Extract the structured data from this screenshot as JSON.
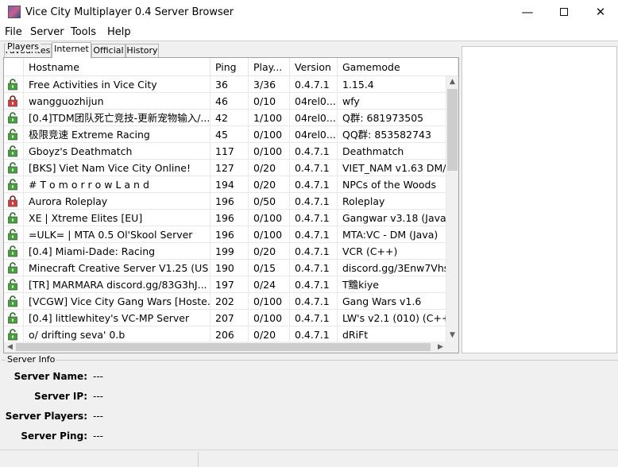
{
  "window": {
    "title": "Vice City Multiplayer 0.4 Server Browser"
  },
  "menu": [
    "File",
    "Server",
    "Tools",
    "Help"
  ],
  "tabs": [
    {
      "label": "Favourites",
      "active": false
    },
    {
      "label": "Internet",
      "active": true
    },
    {
      "label": "Official",
      "active": false
    },
    {
      "label": "History",
      "active": false
    }
  ],
  "columns": [
    "Hostname",
    "Ping",
    "Play...",
    "Version",
    "Gamemode"
  ],
  "servers": [
    {
      "locked": false,
      "host": "Free Activities in Vice City",
      "ping": "36",
      "players": "3/36",
      "version": "0.4.7.1",
      "gamemode": "1.15.4"
    },
    {
      "locked": true,
      "host": " wangguozhijun",
      "ping": "46",
      "players": "0/10",
      "version": "04rel0...",
      "gamemode": "wfy"
    },
    {
      "locked": false,
      "host": "[0.4]TDM团队死亡竞技-更新宠物输入/...",
      "ping": "42",
      "players": "1/100",
      "version": "04rel0...",
      "gamemode": "Q群: 681973505"
    },
    {
      "locked": false,
      "host": "极限竞速 Extreme Racing",
      "ping": "45",
      "players": "0/100",
      "version": "04rel0...",
      "gamemode": "QQ群:  853582743"
    },
    {
      "locked": false,
      "host": "Gboyz's Deathmatch",
      "ping": "117",
      "players": "0/100",
      "version": "0.4.7.1",
      "gamemode": "Deathmatch"
    },
    {
      "locked": false,
      "host": "[BKS] Viet Nam Vice City Online!",
      "ping": "127",
      "players": "0/20",
      "version": "0.4.7.1",
      "gamemode": "VIET_NAM v1.63 DM/..."
    },
    {
      "locked": false,
      "host": "     #  T o m o r r o w L a n d",
      "ping": "194",
      "players": "0/20",
      "version": "0.4.7.1",
      "gamemode": "NPCs of the Woods"
    },
    {
      "locked": true,
      "host": "Aurora Roleplay",
      "ping": "196",
      "players": "0/50",
      "version": "0.4.7.1",
      "gamemode": "Roleplay"
    },
    {
      "locked": false,
      "host": "XE | Xtreme Elites [EU]",
      "ping": "196",
      "players": "0/100",
      "version": "0.4.7.1",
      "gamemode": "Gangwar v3.18 (Java)"
    },
    {
      "locked": false,
      "host": "=ULK= | MTA 0.5 Ol'Skool Server",
      "ping": "196",
      "players": "0/100",
      "version": "0.4.7.1",
      "gamemode": "MTA:VC - DM (Java)"
    },
    {
      "locked": false,
      "host": "[0.4] Miami-Dade: Racing",
      "ping": "199",
      "players": "0/20",
      "version": "0.4.7.1",
      "gamemode": "VCR (C++)"
    },
    {
      "locked": false,
      "host": "Minecraft Creative Server V1.25 (US ...",
      "ping": "190",
      "players": "0/15",
      "version": "0.4.7.1",
      "gamemode": "discord.gg/3Enw7Vhs..."
    },
    {
      "locked": false,
      "host": "[TR] MARMARA discord.gg/83G3hJ...",
      "ping": "197",
      "players": "0/24",
      "version": "0.4.7.1",
      "gamemode": "T黵kiye"
    },
    {
      "locked": false,
      "host": "[VCGW] Vice City Gang Wars [Hoste...",
      "ping": "202",
      "players": "0/100",
      "version": "0.4.7.1",
      "gamemode": "Gang Wars v1.6"
    },
    {
      "locked": false,
      "host": "[0.4] littlewhitey's VC-MP Server",
      "ping": "207",
      "players": "0/100",
      "version": "0.4.7.1",
      "gamemode": "LW's v2.1 (010) (C++)"
    },
    {
      "locked": false,
      "host": "     o/  drifting seva' 0.b",
      "ping": "206",
      "players": "0/20",
      "version": "0.4.7.1",
      "gamemode": "dRiFt"
    }
  ],
  "players_panel": {
    "title": "Players"
  },
  "server_info": {
    "title": "Server Info",
    "fields": [
      {
        "label": "Server Name:",
        "value": "---"
      },
      {
        "label": "Server IP:",
        "value": "---"
      },
      {
        "label": "Server Players:",
        "value": "---"
      },
      {
        "label": "Server Ping:",
        "value": "---"
      }
    ]
  },
  "colors": {
    "lock_open": "#3fa535",
    "lock_closed": "#d83a3a",
    "scroll_thumb": "#cdcdcd"
  }
}
